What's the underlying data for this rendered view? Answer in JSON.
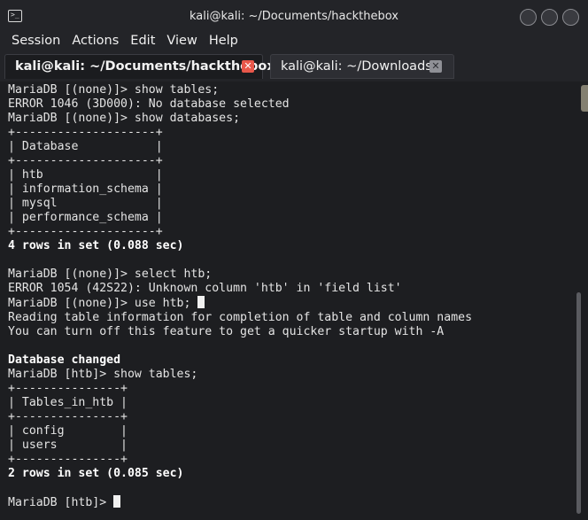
{
  "window": {
    "title": "kali@kali: ~/Documents/hackthebox"
  },
  "menubar": {
    "items": [
      "Session",
      "Actions",
      "Edit",
      "View",
      "Help"
    ]
  },
  "tabs": [
    {
      "label": "kali@kali: ~/Documents/hackthebox",
      "active": true
    },
    {
      "label": "kali@kali: ~/Downloads",
      "active": false
    }
  ],
  "terminal": {
    "lines": [
      "MariaDB [(none)]> show tables;",
      "ERROR 1046 (3D000): No database selected",
      "MariaDB [(none)]> show databases;",
      "+--------------------+",
      "| Database           |",
      "+--------------------+",
      "| htb                |",
      "| information_schema |",
      "| mysql              |",
      "| performance_schema |",
      "+--------------------+",
      "4 rows in set (0.088 sec)",
      "",
      "MariaDB [(none)]> select htb;",
      "ERROR 1054 (42S22): Unknown column 'htb' in 'field list'",
      "MariaDB [(none)]> use htb; ",
      "Reading table information for completion of table and column names",
      "You can turn off this feature to get a quicker startup with -A",
      "",
      "Database changed",
      "MariaDB [htb]> show tables;",
      "+---------------+",
      "| Tables_in_htb |",
      "+---------------+",
      "| config        |",
      "| users         |",
      "+---------------+",
      "2 rows in set (0.085 sec)",
      "",
      "MariaDB [htb]> "
    ],
    "bold_lines": [
      11,
      19,
      27
    ],
    "cursor_lines": [
      15,
      29
    ]
  },
  "colors": {
    "background": "#1d1e21",
    "text": "#e4e4e4",
    "active_tab_close": "#e8574a",
    "inactive_tab_close": "#8f9096"
  },
  "icons": {
    "app": "terminal-icon",
    "window_buttons": [
      "minimize-icon",
      "maximize-icon",
      "close-icon"
    ],
    "tab_close": "close-icon"
  }
}
